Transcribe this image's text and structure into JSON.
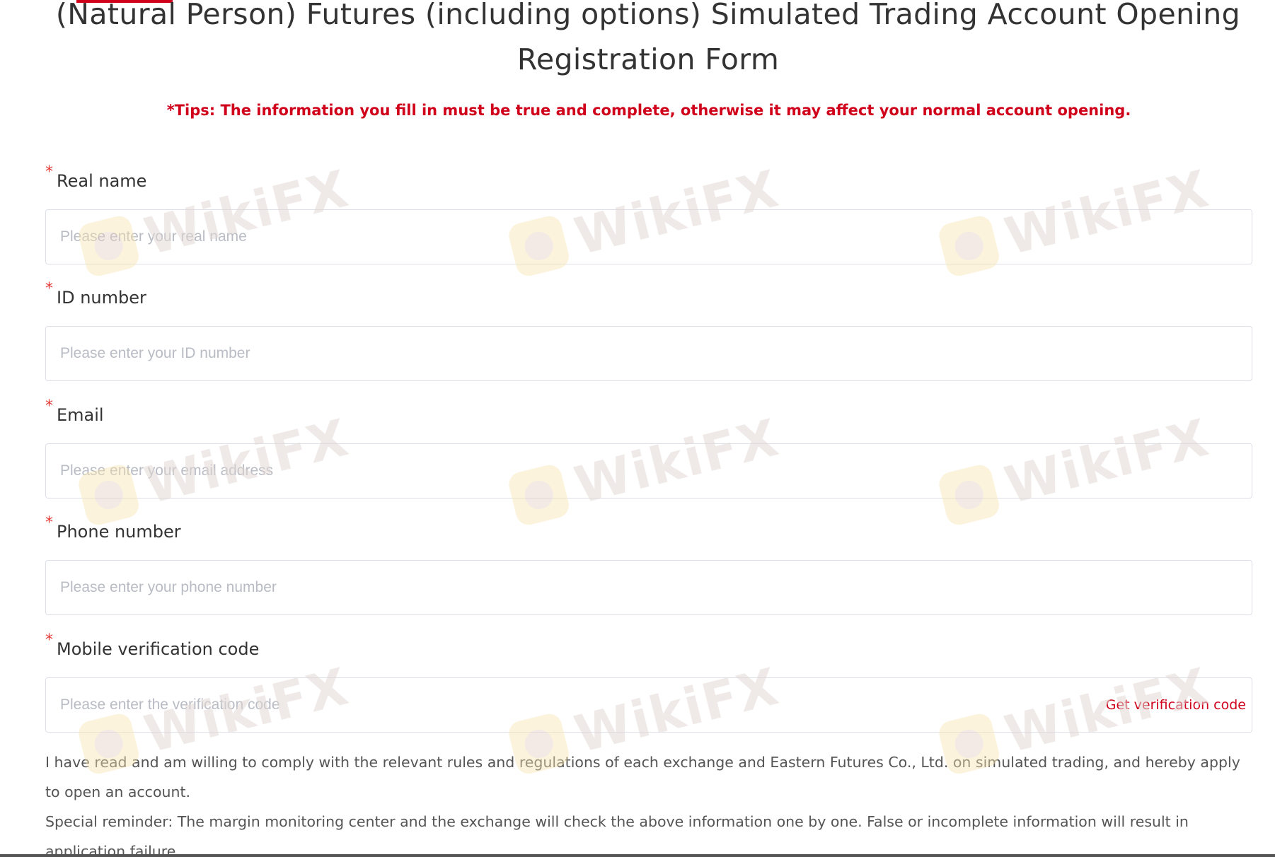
{
  "page": {
    "title": "(Natural Person) Futures (including options) Simulated Trading Account Opening Registration Form",
    "tips": "*Tips: The information you fill in must be true and complete, otherwise it may affect your normal account opening."
  },
  "form": {
    "required_mark": "*",
    "fields": [
      {
        "label": "Real name",
        "placeholder": "Please enter your real name",
        "value": ""
      },
      {
        "label": "ID number",
        "placeholder": "Please enter your ID number",
        "value": ""
      },
      {
        "label": "Email",
        "placeholder": "Please enter your email address",
        "value": ""
      },
      {
        "label": "Phone number",
        "placeholder": "Please enter your phone number",
        "value": ""
      },
      {
        "label": "Mobile verification code",
        "placeholder": "Please enter the verification code",
        "value": "",
        "action_label": "Get verification code"
      }
    ],
    "agreement": "I have read and am willing to comply with the relevant rules and regulations of each exchange and Eastern Futures Co., Ltd. on simulated trading, and hereby apply to open an account.",
    "reminder": "Special reminder: The margin monitoring center and the exchange will check the above information one by one. False or incomplete information will result in application failure."
  },
  "watermark": {
    "text": "WikiFX"
  },
  "colors": {
    "accent": "#d0021b",
    "required": "#e53935",
    "border": "#dcdfe6",
    "placeholder": "#b9bcc4",
    "text": "#333333"
  }
}
